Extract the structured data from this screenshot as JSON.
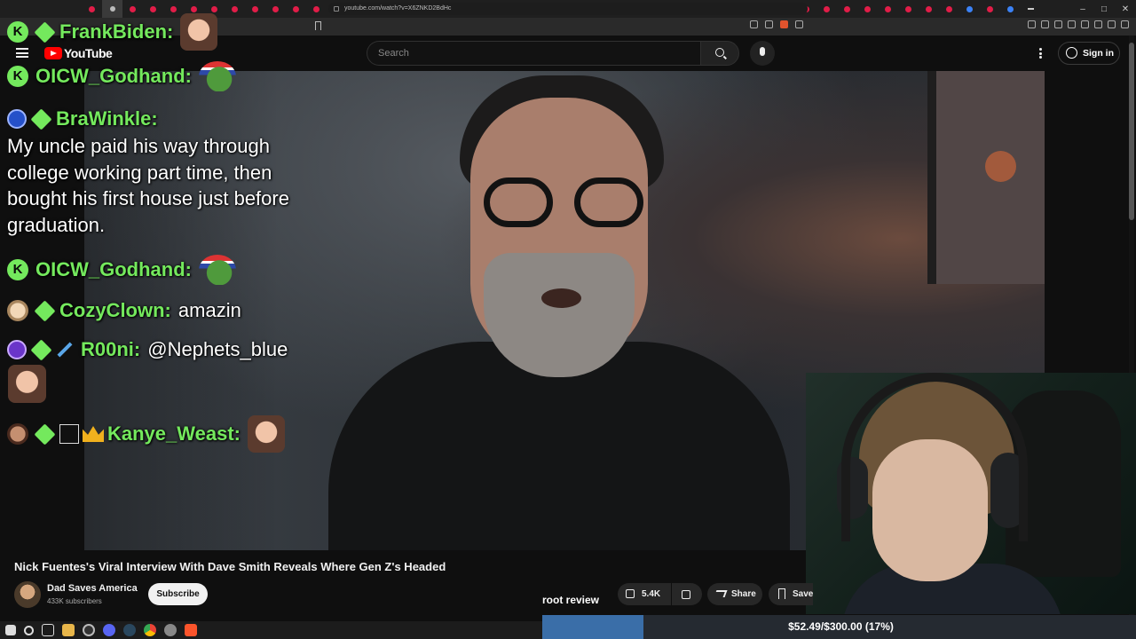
{
  "browser": {
    "url": "youtube.com/watch?v=X6ZNKD2BdHc"
  },
  "youtube": {
    "logo_text": "YouTube",
    "search_placeholder": "Search",
    "signin_label": "Sign in"
  },
  "video": {
    "title": "Nick Fuentes's Viral Interview With Dave Smith Reveals Where Gen Z's Headed",
    "channel_name": "Dad Saves America",
    "subscribers": "433K subscribers",
    "subscribe_label": "Subscribe",
    "likes": "5.4K",
    "share_label": "Share",
    "save_label": "Save"
  },
  "stream_overlay": {
    "label": "root review",
    "goal_text": "$52.49/$300.00 (17%)",
    "goal_fraction": 0.17
  },
  "chat": {
    "messages": [
      {
        "user": "FrankBiden:",
        "text": ""
      },
      {
        "user": "OICW_Godhand:",
        "text": ""
      },
      {
        "user": "BraWinkle:",
        "text": "My uncle paid his way through college working part time, then bought his first house just before graduation."
      },
      {
        "user": "OICW_Godhand:",
        "text": ""
      },
      {
        "user": "CozyClown:",
        "text": "amazin"
      },
      {
        "user": "R00ni:",
        "text": "@Nephets_blue"
      },
      {
        "user": "Kanye_Weast:",
        "text": ""
      }
    ],
    "badge_letter": "K"
  },
  "colors": {
    "chat_username": "#74e95d",
    "youtube_red": "#ff0000",
    "goal_fill": "#3a6ea8"
  }
}
